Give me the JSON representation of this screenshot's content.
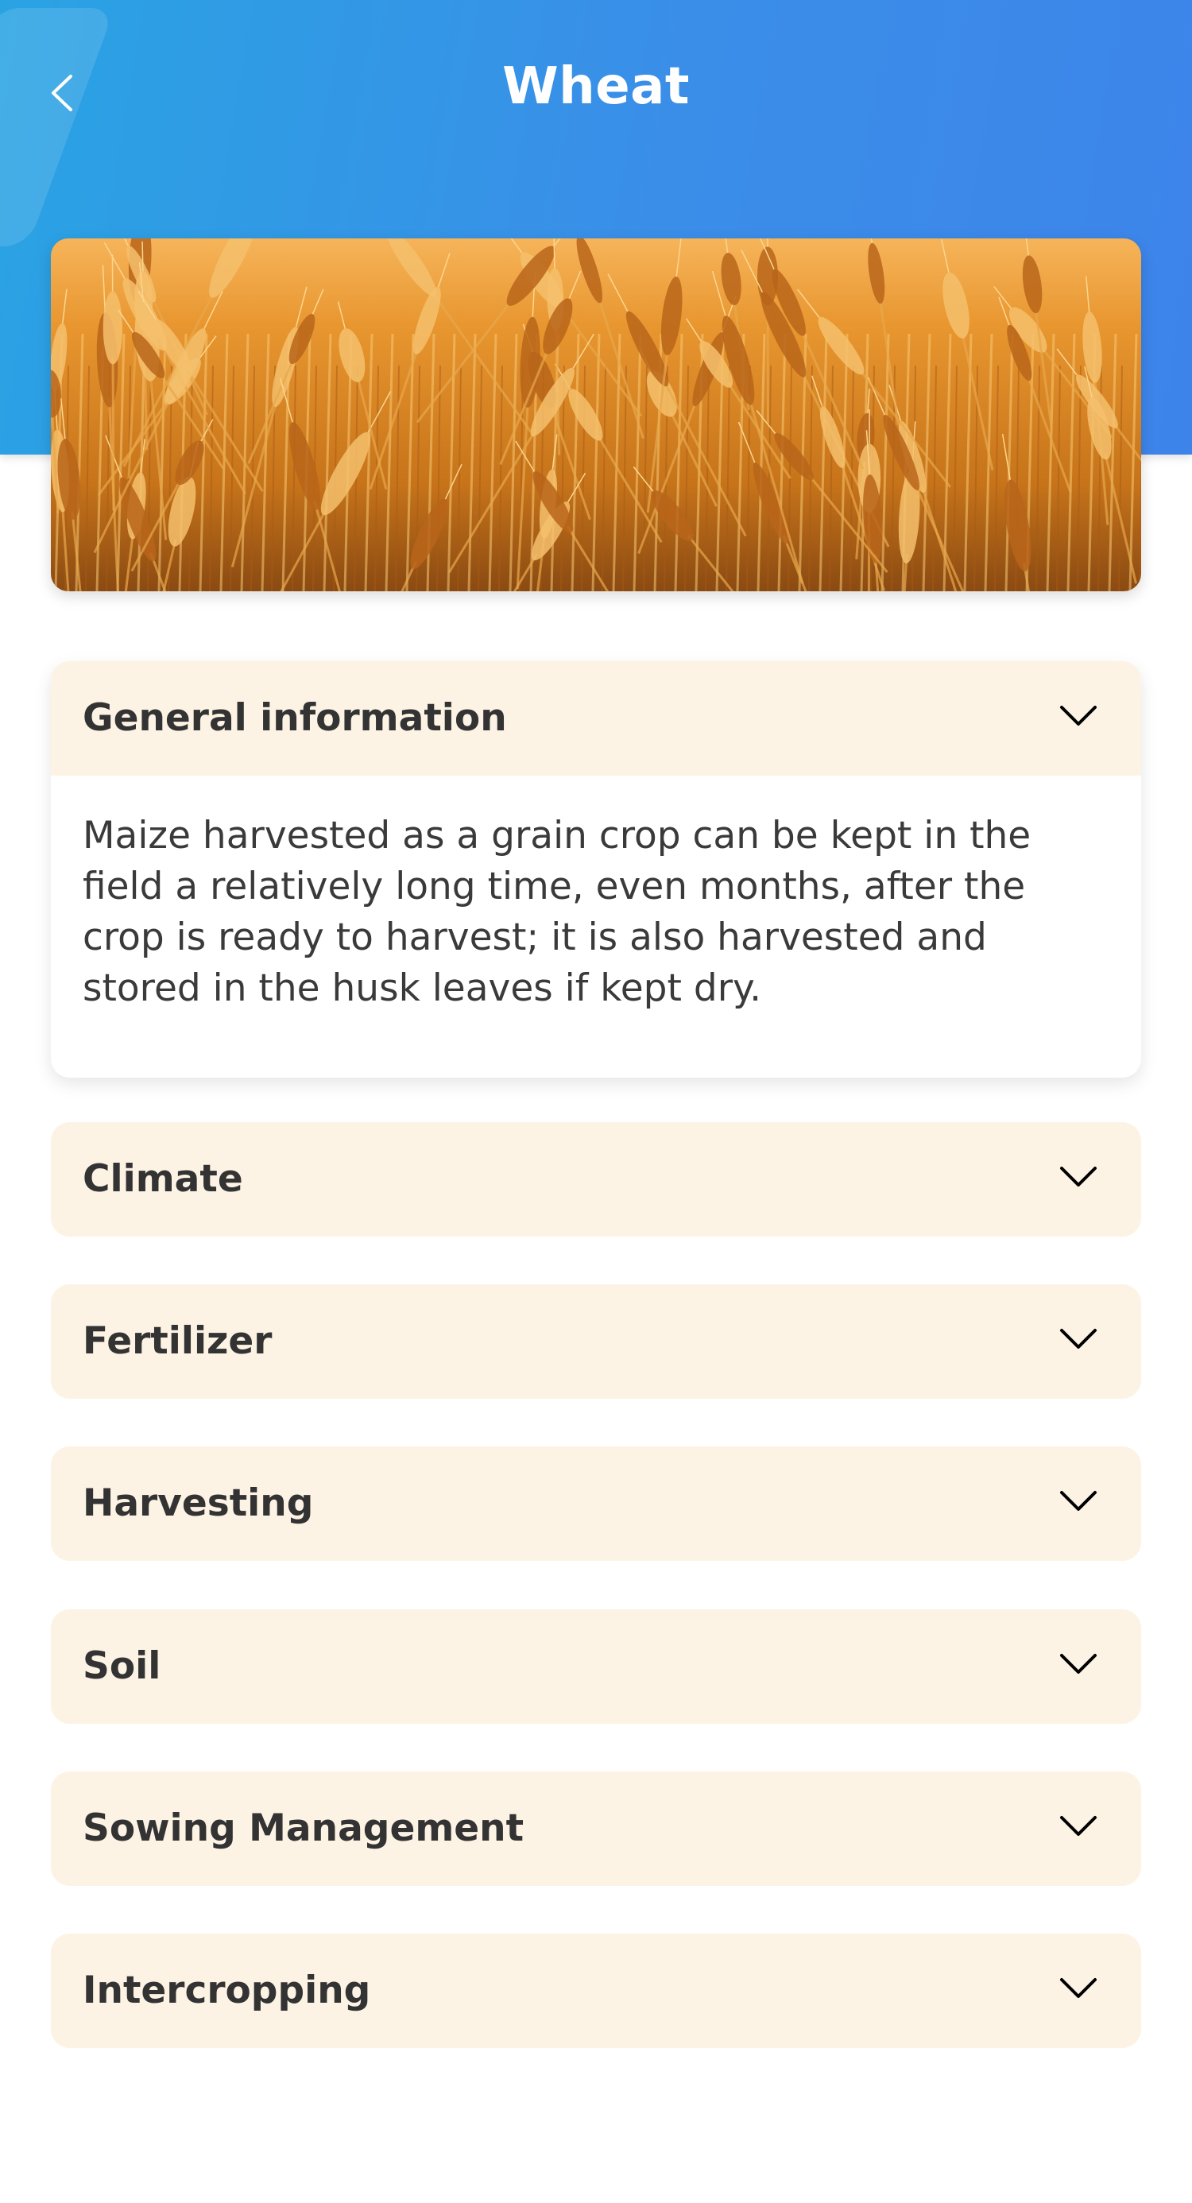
{
  "header": {
    "title": "Wheat",
    "back_icon": "chevron-left-icon",
    "gradient": [
      "#2aa3e3",
      "#3d84ea"
    ]
  },
  "hero_image": {
    "subject": "golden wheat field",
    "colors": [
      "#f0a540",
      "#c87318",
      "#7a3f10"
    ]
  },
  "sections": [
    {
      "title": "General information",
      "expanded": true,
      "body": "Maize harvested as a grain crop can be kept in the field a relatively long time, even months, after the crop is ready to harvest; it is also harvested and stored in the husk leaves if kept dry."
    },
    {
      "title": "Climate",
      "expanded": false
    },
    {
      "title": "Fertilizer",
      "expanded": false
    },
    {
      "title": "Harvesting",
      "expanded": false
    },
    {
      "title": "Soil",
      "expanded": false
    },
    {
      "title": "Sowing Management",
      "expanded": false
    },
    {
      "title": "Intercropping",
      "expanded": false
    }
  ],
  "colors": {
    "card_background": "#fcf3e4",
    "text": "#333333",
    "icon": "#000000"
  }
}
